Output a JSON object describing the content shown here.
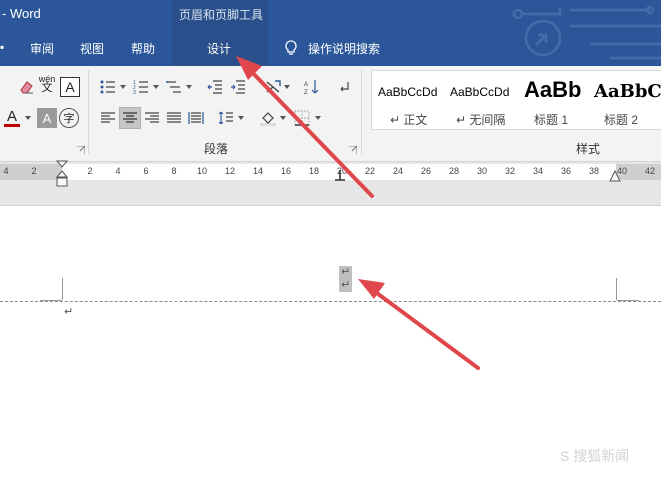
{
  "window": {
    "title": "- Word"
  },
  "context_tab_group": {
    "title": "页眉和页脚工具"
  },
  "tabs": [
    {
      "label": "审阅"
    },
    {
      "label": "视图"
    },
    {
      "label": "帮助"
    },
    {
      "label": "设计",
      "active": true
    }
  ],
  "tell_me": {
    "label": "操作说明搜索"
  },
  "ribbon": {
    "groups": [
      {
        "label": "段落"
      },
      {
        "label": "样式"
      }
    ],
    "font_buttons": {
      "phonetic_top": "wén",
      "phonetic_bottom": "文",
      "char_border": "A",
      "font_color": "A",
      "char_shading": "A",
      "enclose_char": "字"
    }
  },
  "styles": [
    {
      "preview": "AaBbCcDd",
      "name": "正文"
    },
    {
      "preview": "AaBbCcDd",
      "name": "无间隔"
    },
    {
      "preview": "AaBb",
      "name": "标题 1"
    },
    {
      "preview": "AaBbC",
      "name": "标题 2"
    }
  ],
  "ruler": {
    "labels": [
      "4",
      "2",
      "2",
      "4",
      "6",
      "8",
      "10",
      "12",
      "14",
      "16",
      "18",
      "20",
      "22",
      "24",
      "26",
      "28",
      "30",
      "32",
      "34",
      "36",
      "38",
      "40",
      "42"
    ]
  },
  "document": {
    "paragraph_mark": "↵"
  },
  "watermark": {
    "text": "S 搜狐新闻"
  },
  "colors": {
    "title_bar": "#2b579a",
    "arrow": "#e0474c",
    "ribbon": "#f3f3f3"
  }
}
